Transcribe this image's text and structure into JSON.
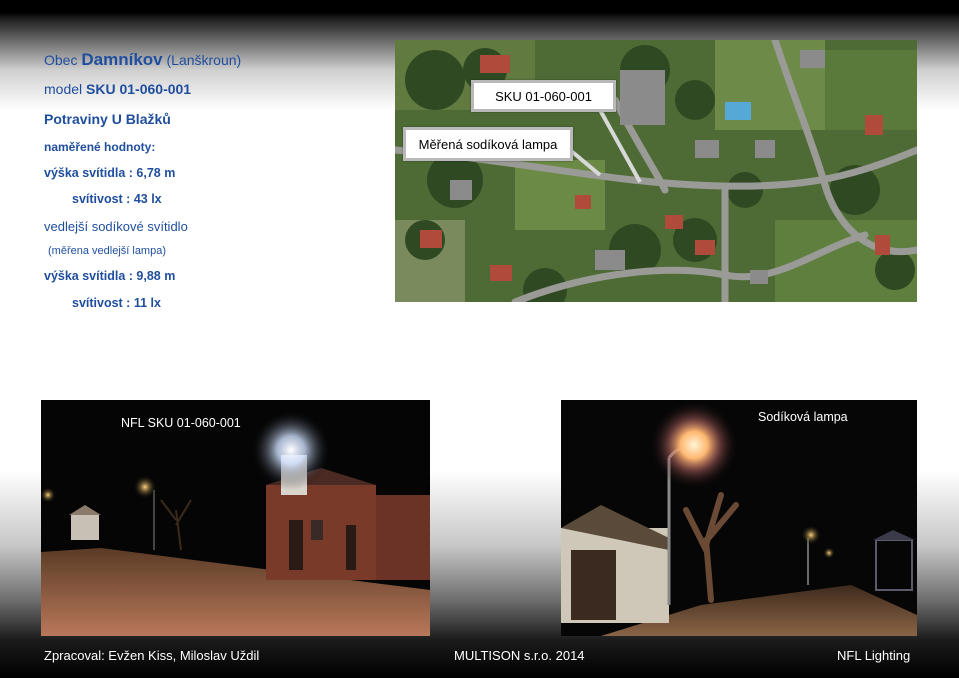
{
  "info": {
    "line1_prefix": "Obec",
    "line1_name": "Damníkov",
    "line1_suffix": "(Lanškroun)",
    "line2_prefix": "model",
    "line2_model": "SKU  01-060-001",
    "line3": "Potraviny U Blažků",
    "line4": "naměřené hodnoty:",
    "line5": "výška svítidla : 6,78 m",
    "line6": "svítivost :  43 lx",
    "line7": "vedlejší sodíkové svítidlo",
    "line8": "(měřena vedlejší lampa)",
    "line9": "výška svítidla : 9,88 m",
    "line10": "svítivost :  11 lx"
  },
  "aerial": {
    "callout_sku": "SKU 01-060-001",
    "callout_lamp": "Měřená sodíková lampa"
  },
  "photos": {
    "left_label": "NFL SKU  01-060-001",
    "right_label": "Sodíková lampa"
  },
  "footer": {
    "left": "Zpracoval: Evžen Kiss, Miloslav Uždil",
    "center": "MULTISON s.r.o. 2014",
    "right": "NFL Lighting"
  },
  "colors": {
    "text_blue": "#1f4e9e",
    "callout_border": "#b9b9b9"
  }
}
